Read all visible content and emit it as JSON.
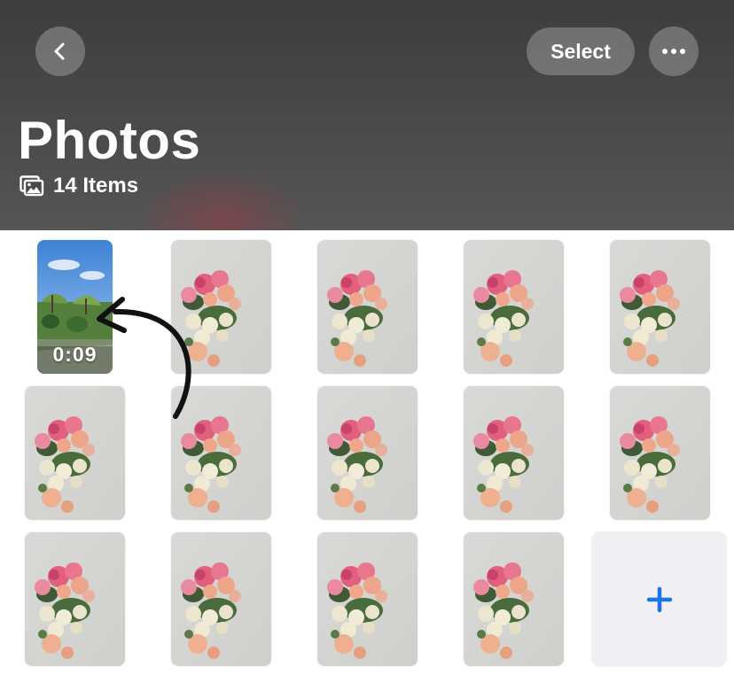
{
  "header": {
    "title": "Photos",
    "item_count": "14 Items",
    "select_label": "Select"
  },
  "icons": {
    "back": "chevron-left-icon",
    "more": "ellipsis-icon",
    "gallery": "photo-stack-icon",
    "add": "plus-icon"
  },
  "grid": {
    "video_duration": "0:09",
    "tiles": [
      {
        "kind": "video"
      },
      {
        "kind": "photo"
      },
      {
        "kind": "photo"
      },
      {
        "kind": "photo"
      },
      {
        "kind": "photo"
      },
      {
        "kind": "photo"
      },
      {
        "kind": "photo"
      },
      {
        "kind": "photo"
      },
      {
        "kind": "photo"
      },
      {
        "kind": "photo"
      },
      {
        "kind": "photo"
      },
      {
        "kind": "photo"
      },
      {
        "kind": "photo"
      },
      {
        "kind": "photo"
      }
    ]
  },
  "colors": {
    "header_bg": "#444444",
    "accent": "#1a73e8",
    "add_tile_bg": "#efeff4"
  }
}
